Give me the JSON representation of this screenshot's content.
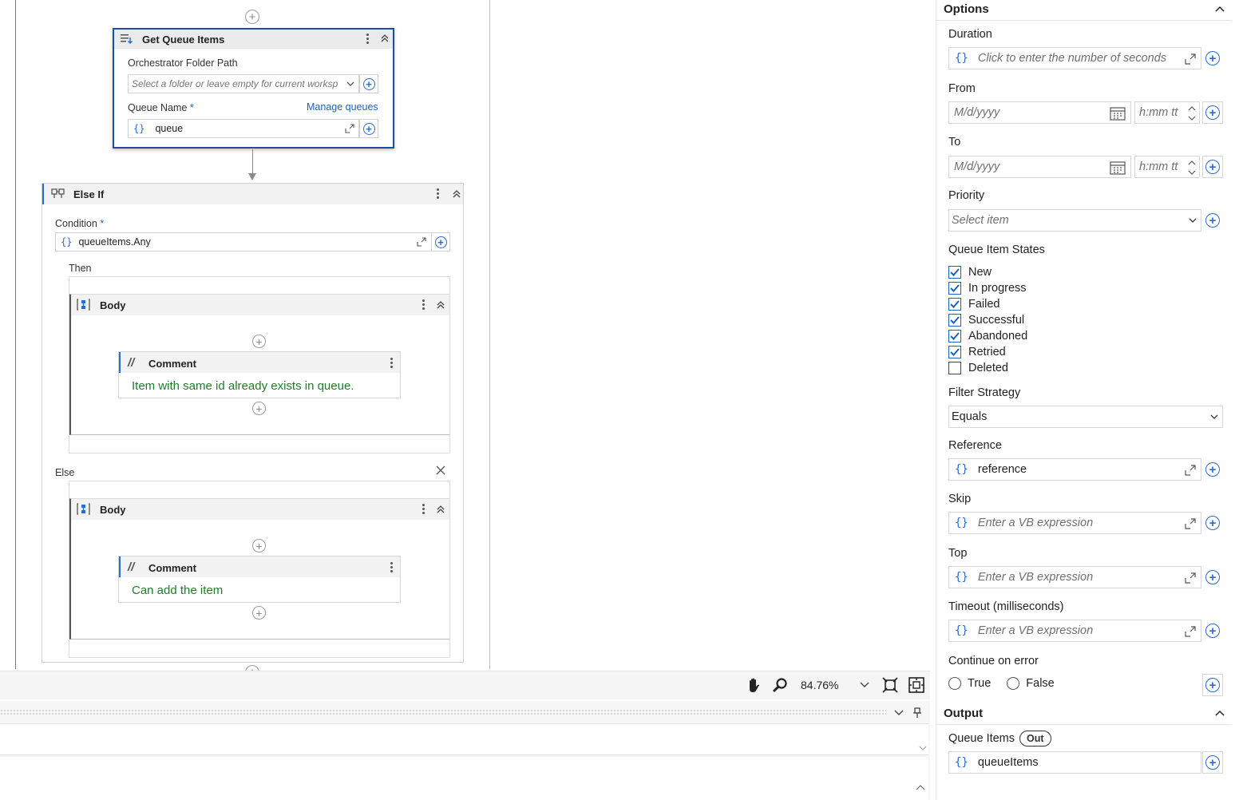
{
  "canvas": {
    "get_queue_items": {
      "title": "Get Queue Items",
      "folder_label": "Orchestrator Folder Path",
      "folder_placeholder": "Select a folder or leave empty for current worksp",
      "queue_label": "Queue Name",
      "required_mark": "*",
      "manage_link": "Manage queues",
      "queue_value": "queue"
    },
    "else_if": {
      "title": "Else If",
      "condition_label": "Condition",
      "required_mark": "*",
      "condition_value": "queueItems.Any",
      "then_label": "Then",
      "else_label": "Else",
      "then_body": {
        "title": "Body",
        "comment_title": "Comment",
        "comment_text": "Item with same id already exists in queue."
      },
      "else_body": {
        "title": "Body",
        "comment_title": "Comment",
        "comment_text": "Can add the item"
      }
    }
  },
  "zoombar": {
    "zoom_level": "84.76%"
  },
  "properties": {
    "options_title": "Options",
    "duration": {
      "label": "Duration",
      "placeholder": "Click to enter the number of seconds"
    },
    "from": {
      "label": "From",
      "date_placeholder": "M/d/yyyy",
      "time_placeholder": "h:mm tt"
    },
    "to": {
      "label": "To",
      "date_placeholder": "M/d/yyyy",
      "time_placeholder": "h:mm tt"
    },
    "priority": {
      "label": "Priority",
      "placeholder": "Select item"
    },
    "queue_item_states": {
      "label": "Queue Item States",
      "items": [
        {
          "label": "New",
          "checked": true
        },
        {
          "label": "In progress",
          "checked": true
        },
        {
          "label": "Failed",
          "checked": true
        },
        {
          "label": "Successful",
          "checked": true
        },
        {
          "label": "Abandoned",
          "checked": true
        },
        {
          "label": "Retried",
          "checked": true
        },
        {
          "label": "Deleted",
          "checked": false
        }
      ]
    },
    "filter_strategy": {
      "label": "Filter Strategy",
      "value": "Equals"
    },
    "reference": {
      "label": "Reference",
      "value": "reference"
    },
    "skip": {
      "label": "Skip",
      "placeholder": "Enter a VB expression"
    },
    "top": {
      "label": "Top",
      "placeholder": "Enter a VB expression"
    },
    "timeout": {
      "label": "Timeout (milliseconds)",
      "placeholder": "Enter a VB expression"
    },
    "continue_on_error": {
      "label": "Continue on error",
      "true_label": "True",
      "false_label": "False"
    },
    "output_title": "Output",
    "queue_items": {
      "label": "Queue Items",
      "badge": "Out",
      "value": "queueItems"
    }
  },
  "colors": {
    "accent": "#2b6bd6",
    "selection_border": "#1a4fa8",
    "comment_green": "#1e7d2a"
  }
}
